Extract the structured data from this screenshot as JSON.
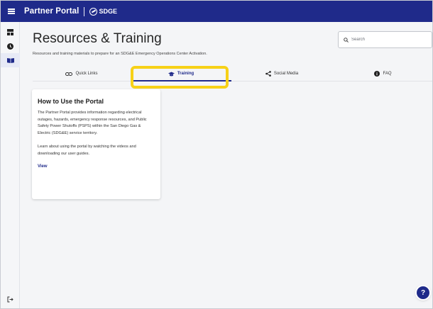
{
  "header": {
    "app_title": "Partner Portal",
    "brand": "SDGE"
  },
  "page": {
    "title": "Resources & Training",
    "subtitle": "Resources and training materials to prepare for an SDG&E Emergency Operations Center Activation."
  },
  "search": {
    "placeholder": "Search"
  },
  "tabs": [
    {
      "label": "Quick Links",
      "icon": "link-icon",
      "active": false
    },
    {
      "label": "Training",
      "icon": "graduation-cap-icon",
      "active": true
    },
    {
      "label": "Social Media",
      "icon": "share-icon",
      "active": false
    },
    {
      "label": "FAQ",
      "icon": "info-icon",
      "active": false
    }
  ],
  "card": {
    "title": "How to Use the Portal",
    "paragraph1": "The Partner Portal provides information regarding electrical outages, hazards, emergency response resources, and Public Safety Power Shutoffs (PSPS) within the San Diego Gas & Electric (SDG&E) service territory.",
    "paragraph2": "Learn about using the portal by watching the videos and downloading our user guides.",
    "link_label": "View"
  },
  "help": {
    "label": "?"
  },
  "colors": {
    "brand_navy": "#1f2a8a",
    "highlight_yellow": "#f7d117"
  }
}
